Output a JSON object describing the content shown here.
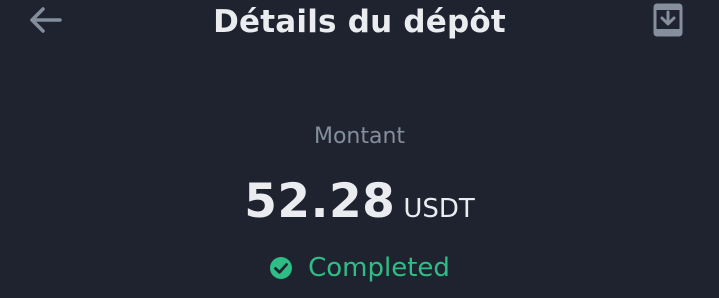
{
  "header": {
    "title": "Détails du dépôt",
    "back_icon": "arrow-left-icon",
    "download_icon": "download-tray-icon"
  },
  "amount": {
    "label": "Montant",
    "value": "52.28",
    "currency": "USDT"
  },
  "status": {
    "icon": "check-circle-icon",
    "text": "Completed",
    "color": "#2ebd85"
  },
  "colors": {
    "background": "#1f2330",
    "text_primary": "#eaecef",
    "text_secondary": "#848e9c",
    "icon_muted": "#848e9c",
    "success": "#2ebd85"
  }
}
